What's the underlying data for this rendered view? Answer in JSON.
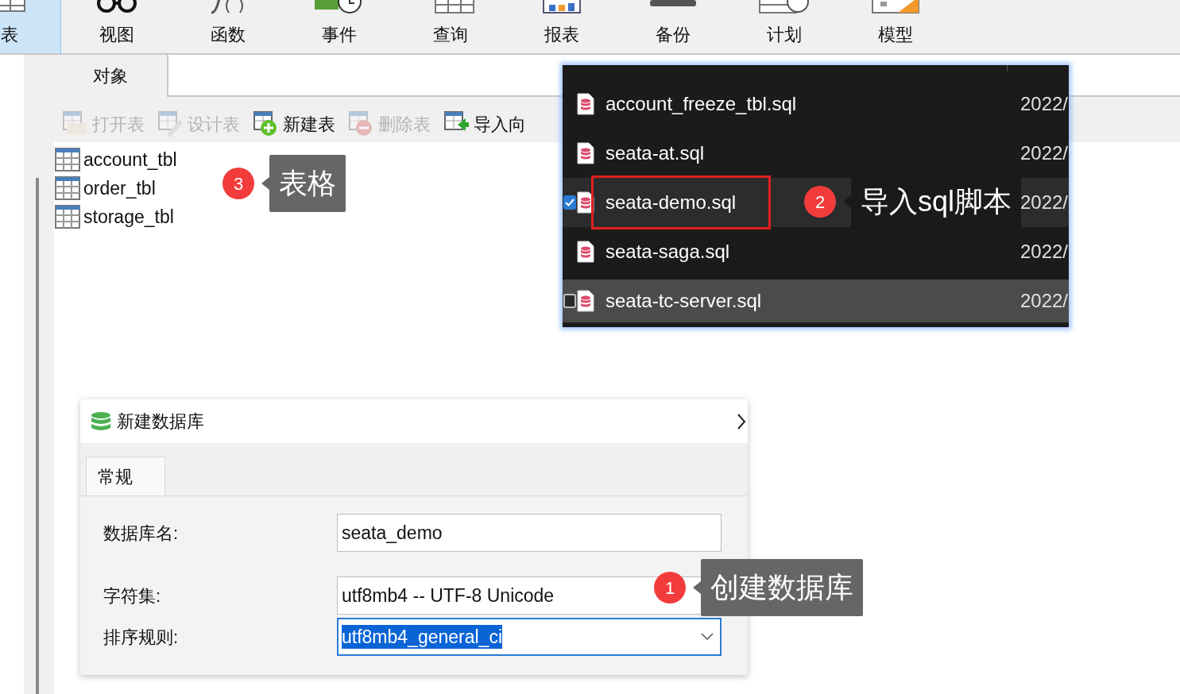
{
  "main_toolbar": [
    {
      "label": "表",
      "selected": true
    },
    {
      "label": "视图",
      "selected": false
    },
    {
      "label": "函数",
      "selected": false
    },
    {
      "label": "事件",
      "selected": false
    },
    {
      "label": "查询",
      "selected": false
    },
    {
      "label": "报表",
      "selected": false
    },
    {
      "label": "备份",
      "selected": false
    },
    {
      "label": "计划",
      "selected": false
    },
    {
      "label": "模型",
      "selected": false
    }
  ],
  "object_tab": {
    "label": "对象",
    "selected": true
  },
  "object_toolbar": [
    {
      "label": "打开表",
      "disabled": true
    },
    {
      "label": "设计表",
      "disabled": true
    },
    {
      "label": "新建表",
      "disabled": false
    },
    {
      "label": "删除表",
      "disabled": true
    },
    {
      "label": "导入向",
      "disabled": false
    }
  ],
  "tables": [
    "account_tbl",
    "order_tbl",
    "storage_tbl"
  ],
  "file_list": [
    {
      "name": "account_freeze_tbl.sql",
      "date": "2022/",
      "selected": false,
      "hovered": false,
      "outlined": false
    },
    {
      "name": "seata-at.sql",
      "date": "2022/",
      "selected": false,
      "hovered": false,
      "outlined": false
    },
    {
      "name": "seata-demo.sql",
      "date": "2022/",
      "selected": false,
      "hovered": true,
      "outlined": true,
      "checked": true
    },
    {
      "name": "seata-saga.sql",
      "date": "2022/",
      "selected": false,
      "hovered": false,
      "outlined": false
    },
    {
      "name": "seata-tc-server.sql",
      "date": "2022/",
      "selected": true,
      "hovered": false,
      "outlined": false,
      "checked": false
    }
  ],
  "dialog": {
    "title": "新建数据库",
    "tabs": [
      {
        "label": "常规",
        "selected": true
      }
    ],
    "fields": [
      {
        "label": "数据库名:",
        "value": "seata_demo",
        "kind": "text",
        "focused": false
      },
      {
        "label": "字符集:",
        "value": "utf8mb4 -- UTF-8 Unicode",
        "kind": "text",
        "focused": false
      },
      {
        "label": "排序规则:",
        "value": "utf8mb4_general_ci",
        "kind": "dropdown",
        "focused": true
      }
    ]
  },
  "annotations": [
    {
      "number": "3",
      "label": "表格",
      "color": "#666666"
    },
    {
      "number": "2",
      "label": "导入sql脚本",
      "color": "#1a1a1a"
    },
    {
      "number": "1",
      "label": "创建数据库",
      "color": "#666666"
    }
  ]
}
